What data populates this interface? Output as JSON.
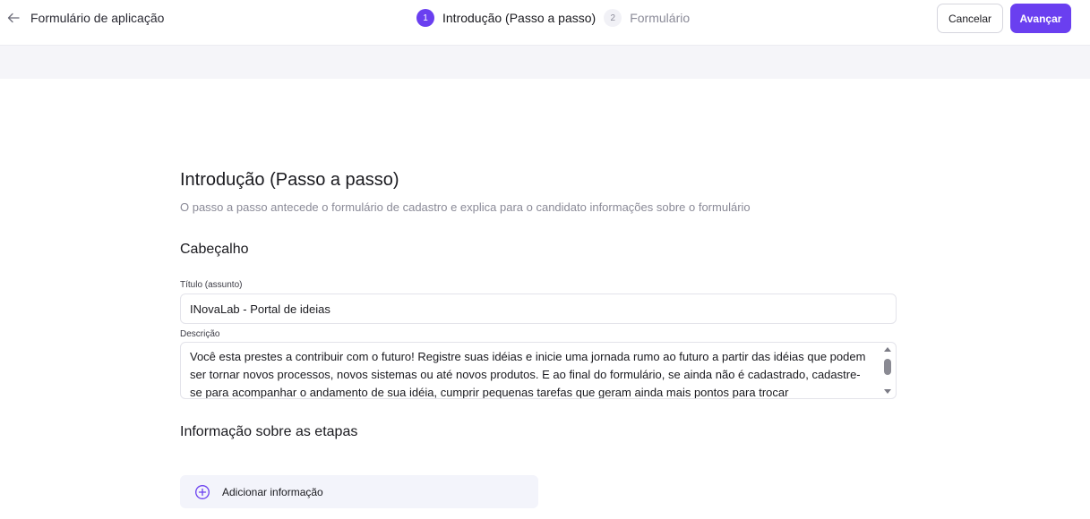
{
  "header": {
    "app_title": "Formulário de aplicação",
    "steps": [
      {
        "number": "1",
        "label": "Introdução (Passo a passo)",
        "active": true
      },
      {
        "number": "2",
        "label": "Formulário",
        "active": false
      }
    ],
    "cancel_label": "Cancelar",
    "next_label": "Avançar"
  },
  "main": {
    "title": "Introdução (Passo a passo)",
    "subtitle": "O passo a passo antecede o formulário de cadastro e explica para o candidato informações sobre o formulário",
    "header_section": {
      "heading": "Cabeçalho",
      "title_label": "Título (assunto)",
      "title_value": "INovaLab - Portal de ideias",
      "description_label": "Descrição",
      "description_value": "Você esta prestes a contribuir com o futuro! Registre suas idéias e inicie uma jornada rumo ao futuro a partir das idéias que podem ser tornar novos processos, novos sistemas ou até novos produtos. E ao final do formulário, se ainda não é cadastrado, cadastre-se para acompanhar o andamento de sua idéia, cumprir pequenas tarefas que geram ainda mais pontos para trocar"
    },
    "steps_section": {
      "heading": "Informação sobre as etapas",
      "add_label": "Adicionar informação"
    }
  },
  "colors": {
    "accent": "#6a3ff0",
    "band": "#f5f5f9",
    "muted_text": "#8a8a97"
  },
  "icons": [
    "arrow-left-icon",
    "plus-circle-icon"
  ]
}
